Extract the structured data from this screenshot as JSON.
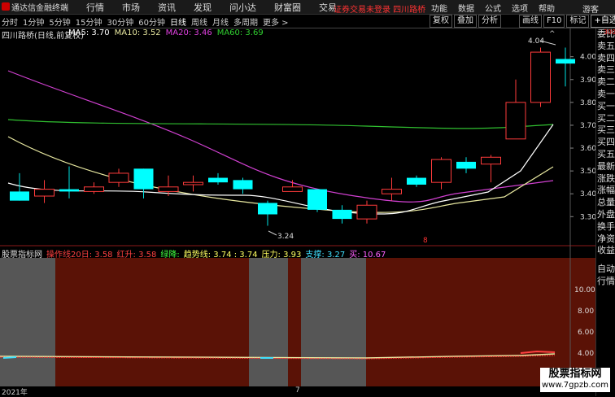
{
  "app": {
    "title": "通达信金融终端"
  },
  "menu": [
    "行情",
    "市场",
    "资讯",
    "发现",
    "问小达",
    "财富圈",
    "交易"
  ],
  "login_warning": "证券交易未登录  四川路桥",
  "right_menu": [
    "功能",
    "数据",
    "公式",
    "选项",
    "帮助"
  ],
  "guest": "游客",
  "tabs": [
    "分时",
    "1分钟",
    "5分钟",
    "15分钟",
    "30分钟",
    "60分钟",
    "日线",
    "周线",
    "月线",
    "多周期",
    "更多 >"
  ],
  "active_tab": "日线",
  "toolbar": [
    "复权",
    "叠加",
    "分析",
    "",
    "画线",
    "F10",
    "标记",
    "+自选",
    "◄"
  ],
  "chart_title": "四川路桥(日线,前复权)",
  "ma": [
    {
      "label": "MA5: 3.70",
      "color": "#ffffff"
    },
    {
      "label": "MA10: 3.52",
      "color": "#e8e8a0"
    },
    {
      "label": "MA20: 3.46",
      "color": "#e040e0"
    },
    {
      "label": "MA60: 3.69",
      "color": "#30d030"
    }
  ],
  "right_panel": [
    "委比",
    "卖五",
    "卖四",
    "卖三",
    "卖二",
    "卖一",
    "买一",
    "买二",
    "买三",
    "买四",
    "买五",
    "最新",
    "涨跌",
    "涨幅",
    "总量",
    "外盘",
    "换手",
    "净资",
    "收益",
    "",
    "自动",
    "行情"
  ],
  "right_panel_top": "300",
  "price_annotations": {
    "high": "4.04",
    "low": "3.24"
  },
  "indicator": {
    "name": "股票指标网",
    "items": [
      {
        "label": "操作线20日: 3.58",
        "color": "#ff4040"
      },
      {
        "label": "红升: 3.58",
        "color": "#ff4040"
      },
      {
        "label": "绿降:",
        "color": "#40ff40"
      },
      {
        "label": "趋势线: 3.74 : 3.74",
        "color": "#ffff60"
      },
      {
        "label": "压力: 3.93",
        "color": "#ffff60"
      },
      {
        "label": "支撑: 3.27",
        "color": "#40e0ff"
      },
      {
        "label": "买: 10.67",
        "color": "#ff60ff"
      }
    ]
  },
  "footer": {
    "year": "2021年",
    "mark": "7"
  },
  "watermark": {
    "line1": "股票指标网",
    "line2": "www.7gpzb.com"
  },
  "chart_data": [
    {
      "type": "candlestick",
      "ylim": [
        3.18,
        4.12
      ],
      "y_ticks": [
        3.3,
        3.4,
        3.5,
        3.6,
        3.7,
        3.8,
        3.9,
        4.0
      ],
      "tick_labels": [
        "3.30",
        "3.40",
        "3.50",
        "3.60",
        "3.70",
        "3.80",
        "3.90",
        "4.00"
      ],
      "candles": [
        {
          "o": 3.41,
          "c": 3.37,
          "h": 3.49,
          "l": 3.37
        },
        {
          "o": 3.39,
          "c": 3.42,
          "h": 3.46,
          "l": 3.36
        },
        {
          "o": 3.42,
          "c": 3.41,
          "h": 3.52,
          "l": 3.38
        },
        {
          "o": 3.41,
          "c": 3.43,
          "h": 3.45,
          "l": 3.4
        },
        {
          "o": 3.45,
          "c": 3.49,
          "h": 3.51,
          "l": 3.43
        },
        {
          "o": 3.51,
          "c": 3.42,
          "h": 3.51,
          "l": 3.38
        },
        {
          "o": 3.41,
          "c": 3.43,
          "h": 3.48,
          "l": 3.39
        },
        {
          "o": 3.44,
          "c": 3.45,
          "h": 3.48,
          "l": 3.41
        },
        {
          "o": 3.47,
          "c": 3.45,
          "h": 3.49,
          "l": 3.44
        },
        {
          "o": 3.46,
          "c": 3.42,
          "h": 3.47,
          "l": 3.4
        },
        {
          "o": 3.36,
          "c": 3.31,
          "h": 3.37,
          "l": 3.26
        },
        {
          "o": 3.41,
          "c": 3.43,
          "h": 3.46,
          "l": 3.41
        },
        {
          "o": 3.42,
          "c": 3.33,
          "h": 3.42,
          "l": 3.32
        },
        {
          "o": 3.33,
          "c": 3.29,
          "h": 3.35,
          "l": 3.27
        },
        {
          "o": 3.29,
          "c": 3.35,
          "h": 3.37,
          "l": 3.27
        },
        {
          "o": 3.4,
          "c": 3.42,
          "h": 3.47,
          "l": 3.37
        },
        {
          "o": 3.47,
          "c": 3.44,
          "h": 3.48,
          "l": 3.43
        },
        {
          "o": 3.45,
          "c": 3.55,
          "h": 3.56,
          "l": 3.42
        },
        {
          "o": 3.54,
          "c": 3.51,
          "h": 3.56,
          "l": 3.49
        },
        {
          "o": 3.53,
          "c": 3.56,
          "h": 3.57,
          "l": 3.45
        },
        {
          "o": 3.64,
          "c": 3.8,
          "h": 3.9,
          "l": 3.66
        },
        {
          "o": 3.8,
          "c": 4.02,
          "h": 4.04,
          "l": 3.78
        },
        {
          "o": 3.99,
          "c": 3.97,
          "h": 4.04,
          "l": 3.87
        }
      ]
    }
  ]
}
